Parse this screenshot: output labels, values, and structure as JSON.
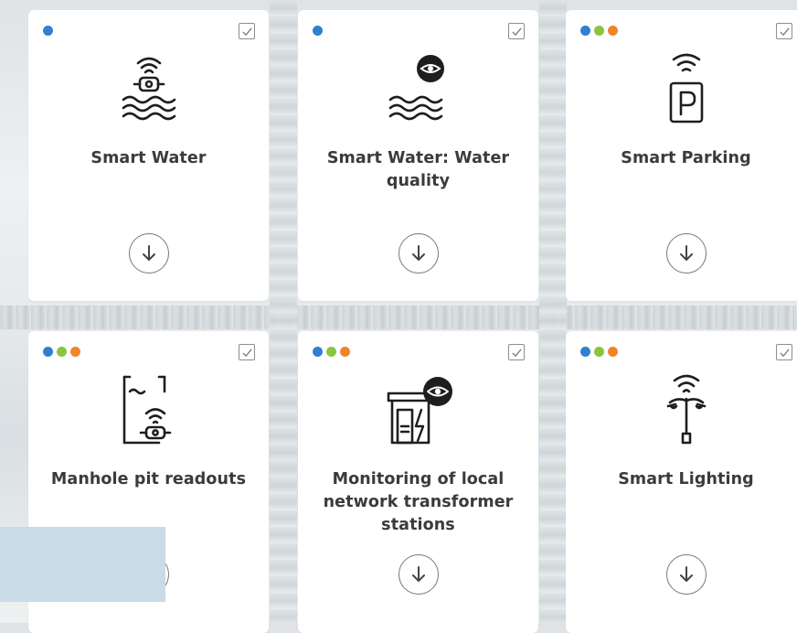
{
  "colors": {
    "blue": "#2f80d1",
    "green": "#8cc43f",
    "orange": "#ef8528"
  },
  "cards": [
    {
      "title": "Smart Water",
      "dots": [
        "blue"
      ],
      "icon": "wireless-water-meter-icon",
      "checked": true
    },
    {
      "title": "Smart Water: Water quality",
      "dots": [
        "blue"
      ],
      "icon": "water-quality-eye-icon",
      "checked": true
    },
    {
      "title": "Smart Parking",
      "dots": [
        "blue",
        "green",
        "orange"
      ],
      "icon": "parking-sign-wireless-icon",
      "checked": true
    },
    {
      "title": "Manhole pit readouts",
      "dots": [
        "blue",
        "green",
        "orange"
      ],
      "icon": "manhole-meter-icon",
      "checked": true
    },
    {
      "title": "Monitoring of local network transformer stations",
      "dots": [
        "blue",
        "green",
        "orange"
      ],
      "icon": "transformer-station-eye-icon",
      "checked": true
    },
    {
      "title": "Smart Lighting",
      "dots": [
        "blue",
        "green",
        "orange"
      ],
      "icon": "street-lamp-wireless-icon",
      "checked": true
    }
  ]
}
